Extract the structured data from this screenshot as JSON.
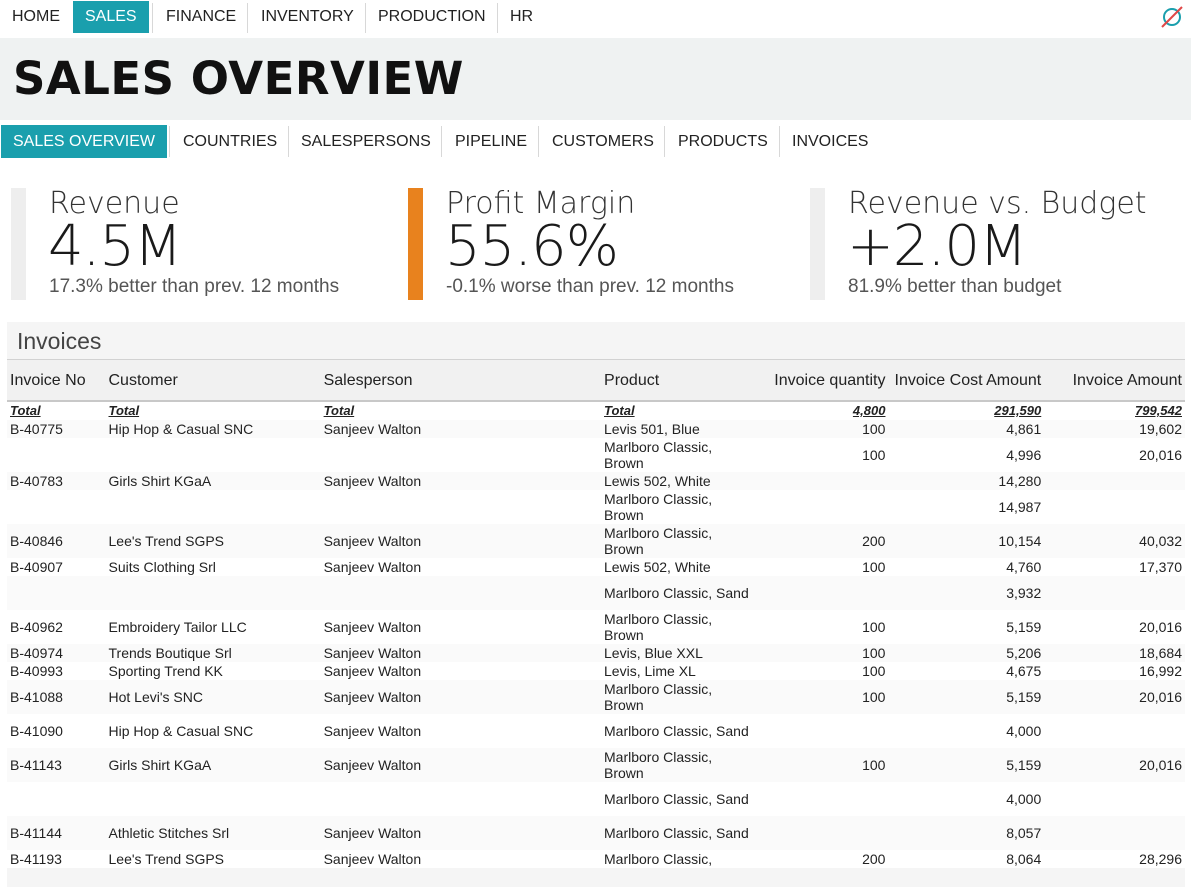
{
  "topnav": {
    "items": [
      {
        "label": "HOME",
        "active": false
      },
      {
        "label": "SALES",
        "active": true
      },
      {
        "label": "FINANCE",
        "active": false
      },
      {
        "label": "INVENTORY",
        "active": false
      },
      {
        "label": "PRODUCTION",
        "active": false
      },
      {
        "label": "HR",
        "active": false
      }
    ],
    "logo_icon": "slashed-circle-icon"
  },
  "page_title": "SALES OVERVIEW",
  "subnav": {
    "items": [
      {
        "label": "SALES OVERVIEW",
        "active": true
      },
      {
        "label": "COUNTRIES",
        "active": false
      },
      {
        "label": "SALESPERSONS",
        "active": false
      },
      {
        "label": "PIPELINE",
        "active": false
      },
      {
        "label": "CUSTOMERS",
        "active": false
      },
      {
        "label": "PRODUCTS",
        "active": false
      },
      {
        "label": "INVOICES",
        "active": false
      }
    ]
  },
  "kpis": [
    {
      "label": "Revenue",
      "value": "4.5M",
      "sub": "17.3% better than prev. 12 months",
      "bar_color": "#eeeeee"
    },
    {
      "label": "Profit Margin",
      "value": "55.6%",
      "sub": "-0.1% worse than prev. 12 months",
      "bar_color": "#e8821e"
    },
    {
      "label": "Revenue vs. Budget",
      "value": "+2.0M",
      "sub": "81.9% better than budget",
      "bar_color": "#eeeeee"
    }
  ],
  "invoices": {
    "title": "Invoices",
    "columns": [
      "Invoice No",
      "Customer",
      "Salesperson",
      "Product",
      "Invoice quantity",
      "Invoice Cost Amount",
      "Invoice Amount"
    ],
    "totals": [
      "Total",
      "Total",
      "Total",
      "Total",
      "4,800",
      "291,590",
      "799,542"
    ],
    "rows": [
      [
        "B-40775",
        "Hip Hop & Casual SNC",
        "Sanjeev Walton",
        "Levis 501, Blue",
        "100",
        "4,861",
        "19,602"
      ],
      [
        "",
        "",
        "",
        "Marlboro Classic, Brown",
        "100",
        "4,996",
        "20,016"
      ],
      [
        "B-40783",
        "Girls Shirt KGaA",
        "Sanjeev Walton",
        "Lewis 502, White",
        "",
        "14,280",
        ""
      ],
      [
        "",
        "",
        "",
        "Marlboro Classic, Brown",
        "",
        "14,987",
        ""
      ],
      [
        "B-40846",
        "Lee's Trend SGPS",
        "Sanjeev Walton",
        "Marlboro Classic, Brown",
        "200",
        "10,154",
        "40,032"
      ],
      [
        "B-40907",
        "Suits Clothing Srl",
        "Sanjeev Walton",
        "Lewis 502, White",
        "100",
        "4,760",
        "17,370"
      ],
      [
        "",
        "",
        "",
        "Marlboro Classic, Sand",
        "",
        "3,932",
        ""
      ],
      [
        "B-40962",
        "Embroidery Tailor LLC",
        "Sanjeev Walton",
        "Marlboro Classic, Brown",
        "100",
        "5,159",
        "20,016"
      ],
      [
        "B-40974",
        "Trends Boutique Srl",
        "Sanjeev Walton",
        "Levis, Blue XXL",
        "100",
        "5,206",
        "18,684"
      ],
      [
        "B-40993",
        "Sporting Trend KK",
        "Sanjeev Walton",
        "Levis, Lime XL",
        "100",
        "4,675",
        "16,992"
      ],
      [
        "B-41088",
        "Hot Levi's SNC",
        "Sanjeev Walton",
        "Marlboro Classic, Brown",
        "100",
        "5,159",
        "20,016"
      ],
      [
        "B-41090",
        "Hip Hop & Casual SNC",
        "Sanjeev Walton",
        "Marlboro Classic, Sand",
        "",
        "4,000",
        ""
      ],
      [
        "B-41143",
        "Girls Shirt KGaA",
        "Sanjeev Walton",
        "Marlboro Classic, Brown",
        "100",
        "5,159",
        "20,016"
      ],
      [
        "",
        "",
        "",
        "Marlboro Classic, Sand",
        "",
        "4,000",
        ""
      ],
      [
        "B-41144",
        "Athletic Stitches Srl",
        "Sanjeev Walton",
        "Marlboro Classic, Sand",
        "",
        "8,057",
        ""
      ],
      [
        "B-41193",
        "Lee's Trend SGPS",
        "Sanjeev Walton",
        "Marlboro Classic,",
        "200",
        "8,064",
        "28,296"
      ]
    ]
  }
}
